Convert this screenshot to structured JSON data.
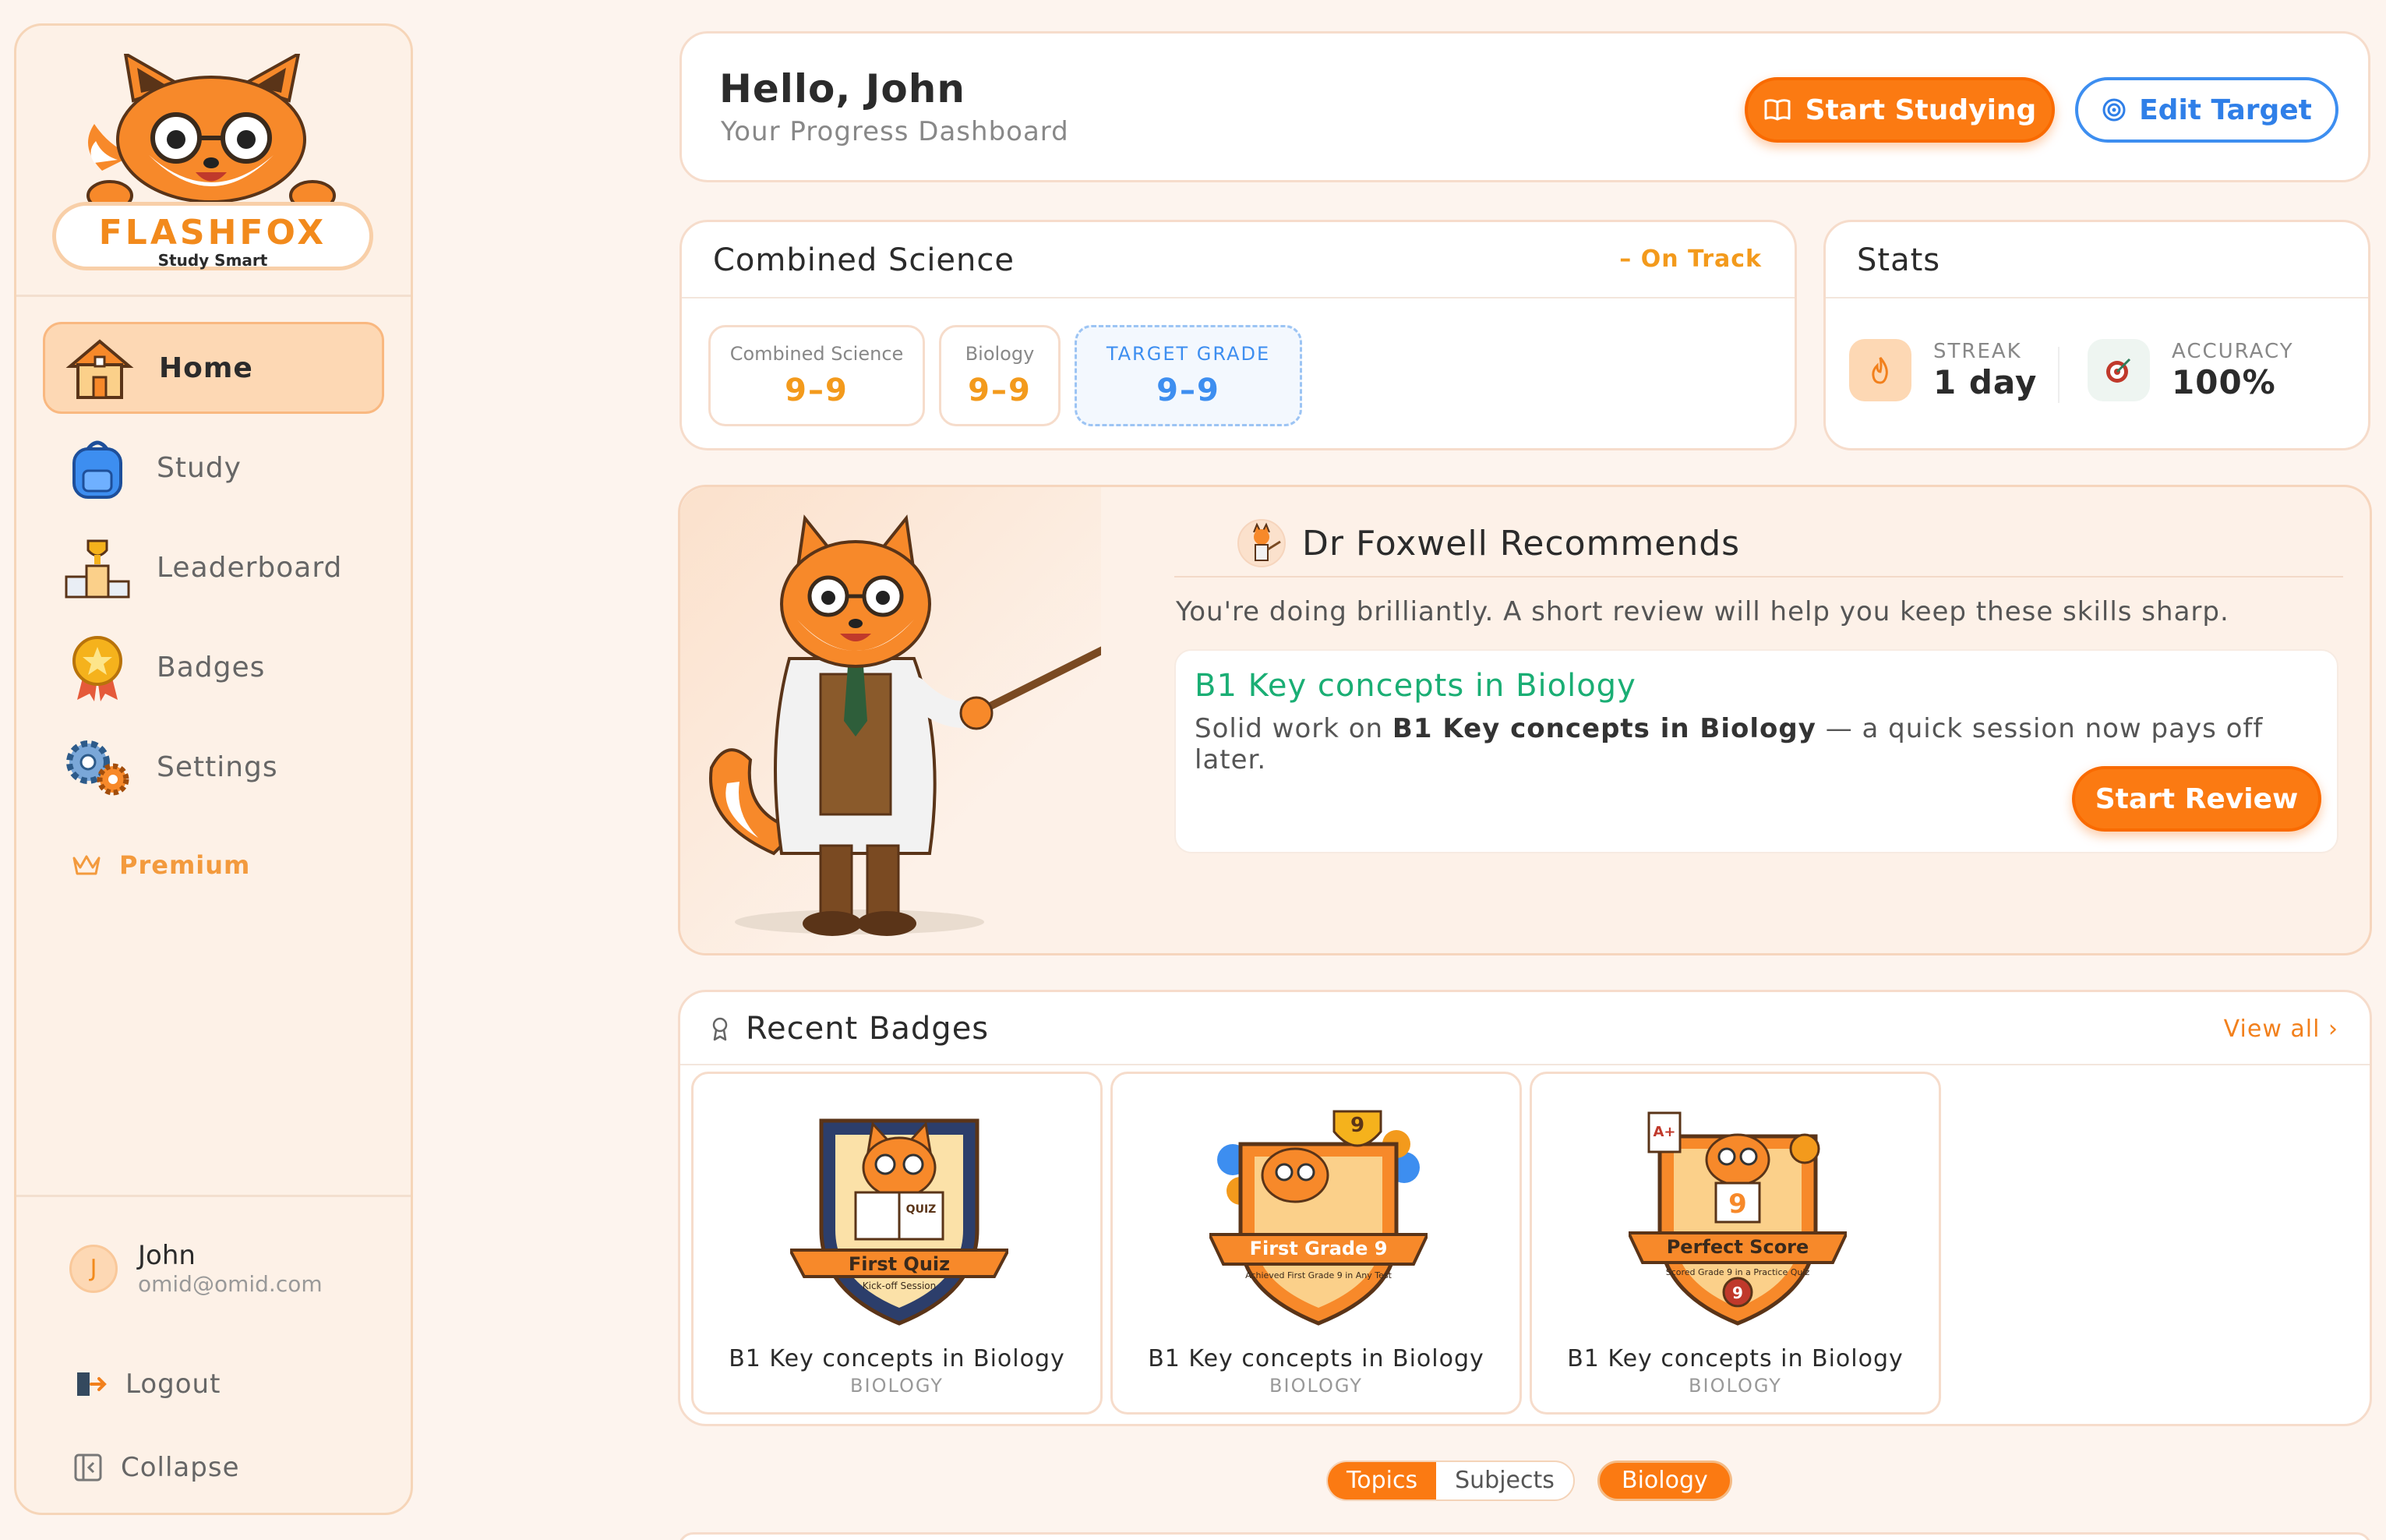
{
  "brand": {
    "name": "FLASHFOX",
    "tagline": "Study Smart"
  },
  "nav": {
    "items": [
      {
        "label": "Home",
        "icon": "house-icon",
        "active": true
      },
      {
        "label": "Study",
        "icon": "backpack-icon"
      },
      {
        "label": "Leaderboard",
        "icon": "podium-icon"
      },
      {
        "label": "Badges",
        "icon": "medal-icon"
      },
      {
        "label": "Settings",
        "icon": "gears-icon"
      }
    ],
    "premium": "Premium"
  },
  "user": {
    "initial": "J",
    "name": "John",
    "email": "omid@omid.com"
  },
  "side_actions": {
    "logout": "Logout",
    "collapse": "Collapse"
  },
  "header": {
    "greeting": "Hello, John",
    "subtitle": "Your Progress Dashboard",
    "start_button": "Start Studying",
    "edit_button": "Edit Target"
  },
  "science": {
    "title": "Combined Science",
    "status": "– On Track",
    "grades": [
      {
        "label": "Combined Science",
        "value": "9–9"
      },
      {
        "label": "Biology",
        "value": "9–9"
      },
      {
        "label": "TARGET GRADE",
        "value": "9–9"
      }
    ]
  },
  "stats": {
    "title": "Stats",
    "streak_label": "STREAK",
    "streak_value": "1 day",
    "accuracy_label": "ACCURACY",
    "accuracy_value": "100%"
  },
  "recommendation": {
    "title": "Dr Foxwell Recommends",
    "message": "You're doing brilliantly. A short review will help you keep these skills sharp.",
    "topic": "B1 Key concepts in Biology",
    "desc_prefix": "Solid work on",
    "desc_topic": "B1 Key concepts in Biology",
    "desc_suffix": "— a quick session now pays off later.",
    "button": "Start Review"
  },
  "badges": {
    "title": "Recent Badges",
    "view_all": "View all ›",
    "items": [
      {
        "badge_text": "First Quiz",
        "badge_sub": "Kick-off Session",
        "name": "B1 Key concepts in Biology",
        "subject": "BIOLOGY"
      },
      {
        "badge_text": "First Grade 9",
        "badge_sub": "Achieved First Grade 9 in Any Test",
        "name": "B1 Key concepts in Biology",
        "subject": "BIOLOGY"
      },
      {
        "badge_text": "Perfect Score",
        "badge_sub": "Scored Grade 9 in a Practice Quiz",
        "name": "B1 Key concepts in Biology",
        "subject": "BIOLOGY"
      }
    ]
  },
  "filters": {
    "tabs": [
      "Topics",
      "Subjects"
    ],
    "active_tab": "Topics",
    "chip": "Biology"
  },
  "colors": {
    "accent": "#fb7a12",
    "blue": "#3d8ef0",
    "green": "#1aae74",
    "bg": "#fdf4ee"
  }
}
